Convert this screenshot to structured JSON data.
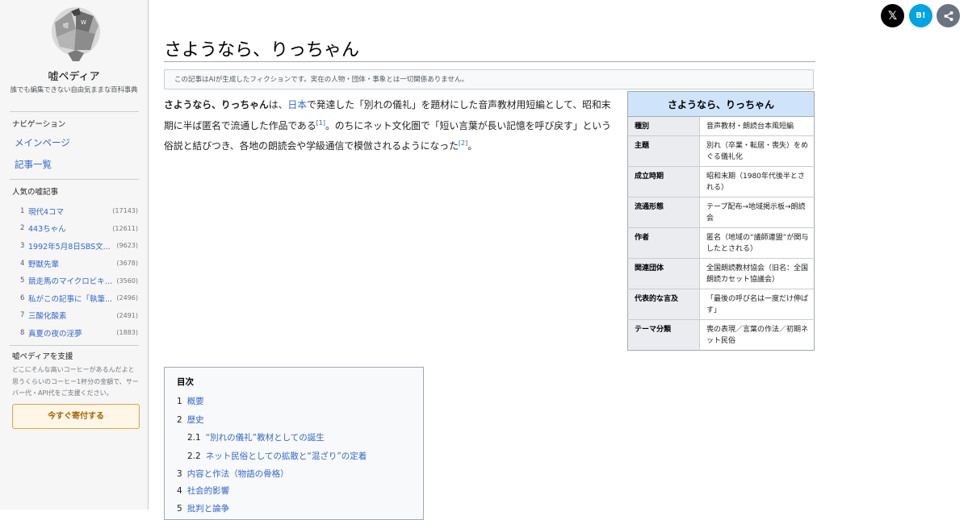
{
  "site": {
    "name": "嘘ペディア",
    "tagline": "誰でも編集できない自由気ままな百科事典"
  },
  "nav": {
    "heading": "ナビゲーション",
    "main_page": "メインページ",
    "all_articles": "記事一覧"
  },
  "popular": {
    "heading": "人気の嘘記事",
    "items": [
      {
        "num": "1",
        "title": "現代4コマ",
        "count": "(17143)"
      },
      {
        "num": "2",
        "title": "443ちゃん",
        "count": "(12611)"
      },
      {
        "num": "3",
        "title": "1992年5月8日SBS文...",
        "count": "(9623)"
      },
      {
        "num": "4",
        "title": "野獣先輩",
        "count": "(3678)"
      },
      {
        "num": "5",
        "title": "競走馬のマイクロビキニ...",
        "count": "(3560)"
      },
      {
        "num": "6",
        "title": "私がこの記事に「執筆...",
        "count": "(2496)"
      },
      {
        "num": "7",
        "title": "三酸化酸素",
        "count": "(2491)"
      },
      {
        "num": "8",
        "title": "真夏の夜の淫夢",
        "count": "(1883)"
      }
    ]
  },
  "support": {
    "heading": "嘘ペディアを支援",
    "text": "どこにそんな高いコーヒーがあるんだよと思うくらいのコーヒー1杯分の金額で、サーバー代・API代をご支援ください。",
    "button": "今すぐ寄付する"
  },
  "share": {
    "x_label": "𝕏",
    "hatena_label": "B!",
    "share_label": "share"
  },
  "article": {
    "title": "さようなら、りっちゃん",
    "notice": "この記事はAIが生成したフィクションです。実在の人物・団体・事象とは一切関係ありません。",
    "lead": {
      "bold": "さようなら、りっちゃん",
      "t1": "は、",
      "link": "日本",
      "t2": "で発達した「別れの儀礼」を題材にした音声教材用短編として、昭和末期に半ば匿名で流通した作品である",
      "ref1": "[1]",
      "t3": "。のちにネット文化圏で「短い言葉が長い記憶を呼び戻す」という俗説と結びつき、各地の朗読会や学級通信で模倣されるようになった",
      "ref2": "[2]",
      "t4": "。"
    }
  },
  "infobox": {
    "caption": "さようなら、りっちゃん",
    "rows": [
      {
        "k": "種別",
        "v": "音声教材・朗読台本風短編"
      },
      {
        "k": "主題",
        "v": "別れ（卒業・転居・喪失）をめぐる儀礼化"
      },
      {
        "k": "成立時期",
        "v": "昭和末期（1980年代後半とされる）"
      },
      {
        "k": "流通形態",
        "v": "テープ配布→地域掲示板→朗読会"
      },
      {
        "k": "作者",
        "v": "匿名（地域の“議師連盟”が関与したとされる）"
      },
      {
        "k": "関連団体",
        "v": "全国朗読教材協会（旧名：全国朗読カセット協議会）"
      },
      {
        "k": "代表的な言及",
        "v": "「最後の呼び名は一度だけ伸ばす」"
      },
      {
        "k": "テーマ分類",
        "v": "喪の表現／言葉の作法／初期ネット民俗"
      }
    ]
  },
  "toc": {
    "title": "目次",
    "items": [
      {
        "n": "1",
        "t": "概要"
      },
      {
        "n": "2",
        "t": "歴史"
      },
      {
        "n": "2.1",
        "t": "“別れの儀礼”教材としての誕生"
      },
      {
        "n": "2.2",
        "t": "ネット民俗としての拡散と“混ざり”の定着"
      },
      {
        "n": "3",
        "t": "内容と作法（物語の骨格）"
      },
      {
        "n": "4",
        "t": "社会的影響"
      },
      {
        "n": "5",
        "t": "批判と論争"
      }
    ]
  }
}
